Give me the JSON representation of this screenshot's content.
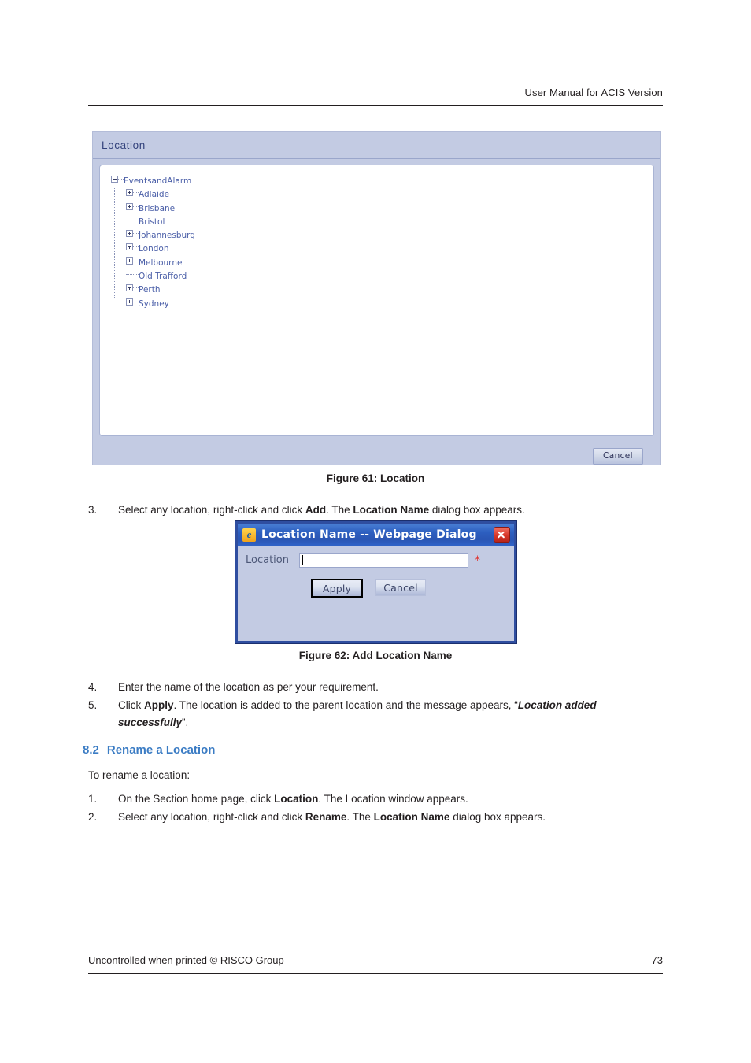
{
  "header": {
    "running_head": "User Manual for ACIS Version"
  },
  "figure61": {
    "panel_title": "Location",
    "cancel_label": "Cancel",
    "caption": "Figure 61: Location",
    "tree": [
      {
        "label": "EventsandAlarm",
        "level": 0,
        "icon": "minus-box"
      },
      {
        "label": "Adlaide",
        "level": 1,
        "icon": "plus-box"
      },
      {
        "label": "Brisbane",
        "level": 1,
        "icon": "plus-box"
      },
      {
        "label": "Bristol",
        "level": 1,
        "icon": "leaf"
      },
      {
        "label": "Johannesburg",
        "level": 1,
        "icon": "plus-box"
      },
      {
        "label": "London",
        "level": 1,
        "icon": "plus-box"
      },
      {
        "label": "Melbourne",
        "level": 1,
        "icon": "plus-box"
      },
      {
        "label": "Old Trafford",
        "level": 1,
        "icon": "leaf"
      },
      {
        "label": "Perth",
        "level": 1,
        "icon": "plus-box"
      },
      {
        "label": "Sydney",
        "level": 1,
        "icon": "plus-box"
      }
    ]
  },
  "step3": {
    "number": "3.",
    "text_a": "Select any location, right-click and click ",
    "bold_a": "Add",
    "text_b": ". The ",
    "bold_b": "Location Name",
    "text_c": " dialog box appears."
  },
  "figure62": {
    "dialog_title": "Location Name -- Webpage Dialog",
    "ie_icon_glyph": "e",
    "close_label": "Close",
    "field_label": "Location",
    "field_value": "",
    "field_placeholder": "",
    "required_marker": "*",
    "apply_label": "Apply",
    "cancel_label": "Cancel",
    "caption": "Figure 62: Add Location Name"
  },
  "step4": {
    "number": "4.",
    "text": "Enter the name of the location as per your requirement."
  },
  "step5": {
    "number": "5.",
    "text_a": "Click ",
    "bold_a": "Apply",
    "text_b": ". The location is added to the parent location and the message appears, “",
    "bolditalic": "Location added successfully",
    "text_c": "”."
  },
  "section": {
    "number": "8.2",
    "title": "Rename a Location",
    "intro": "To rename a location:"
  },
  "rename_steps": [
    {
      "number": "1.",
      "text_a": "On the Section home page, click ",
      "bold_a": "Location",
      "text_b": ". The Location window appears.",
      "bold_b": "",
      "text_c": ""
    },
    {
      "number": "2.",
      "text_a": "Select any location, right-click and click ",
      "bold_a": "Rename",
      "text_b": ". The ",
      "bold_b": "Location Name",
      "text_c": " dialog box appears."
    }
  ],
  "footer": {
    "left": "Uncontrolled when printed © RISCO Group",
    "page_number": "73"
  },
  "colors": {
    "accent_heading": "#3b7cc4",
    "panel_bg": "#c3cbe3",
    "panel_title_text": "#33427c",
    "tree_text": "#4b5fa8",
    "dialog_titlebar": "#2d5fc0",
    "close_button": "#d8372a",
    "required_asterisk": "#e0322d"
  }
}
